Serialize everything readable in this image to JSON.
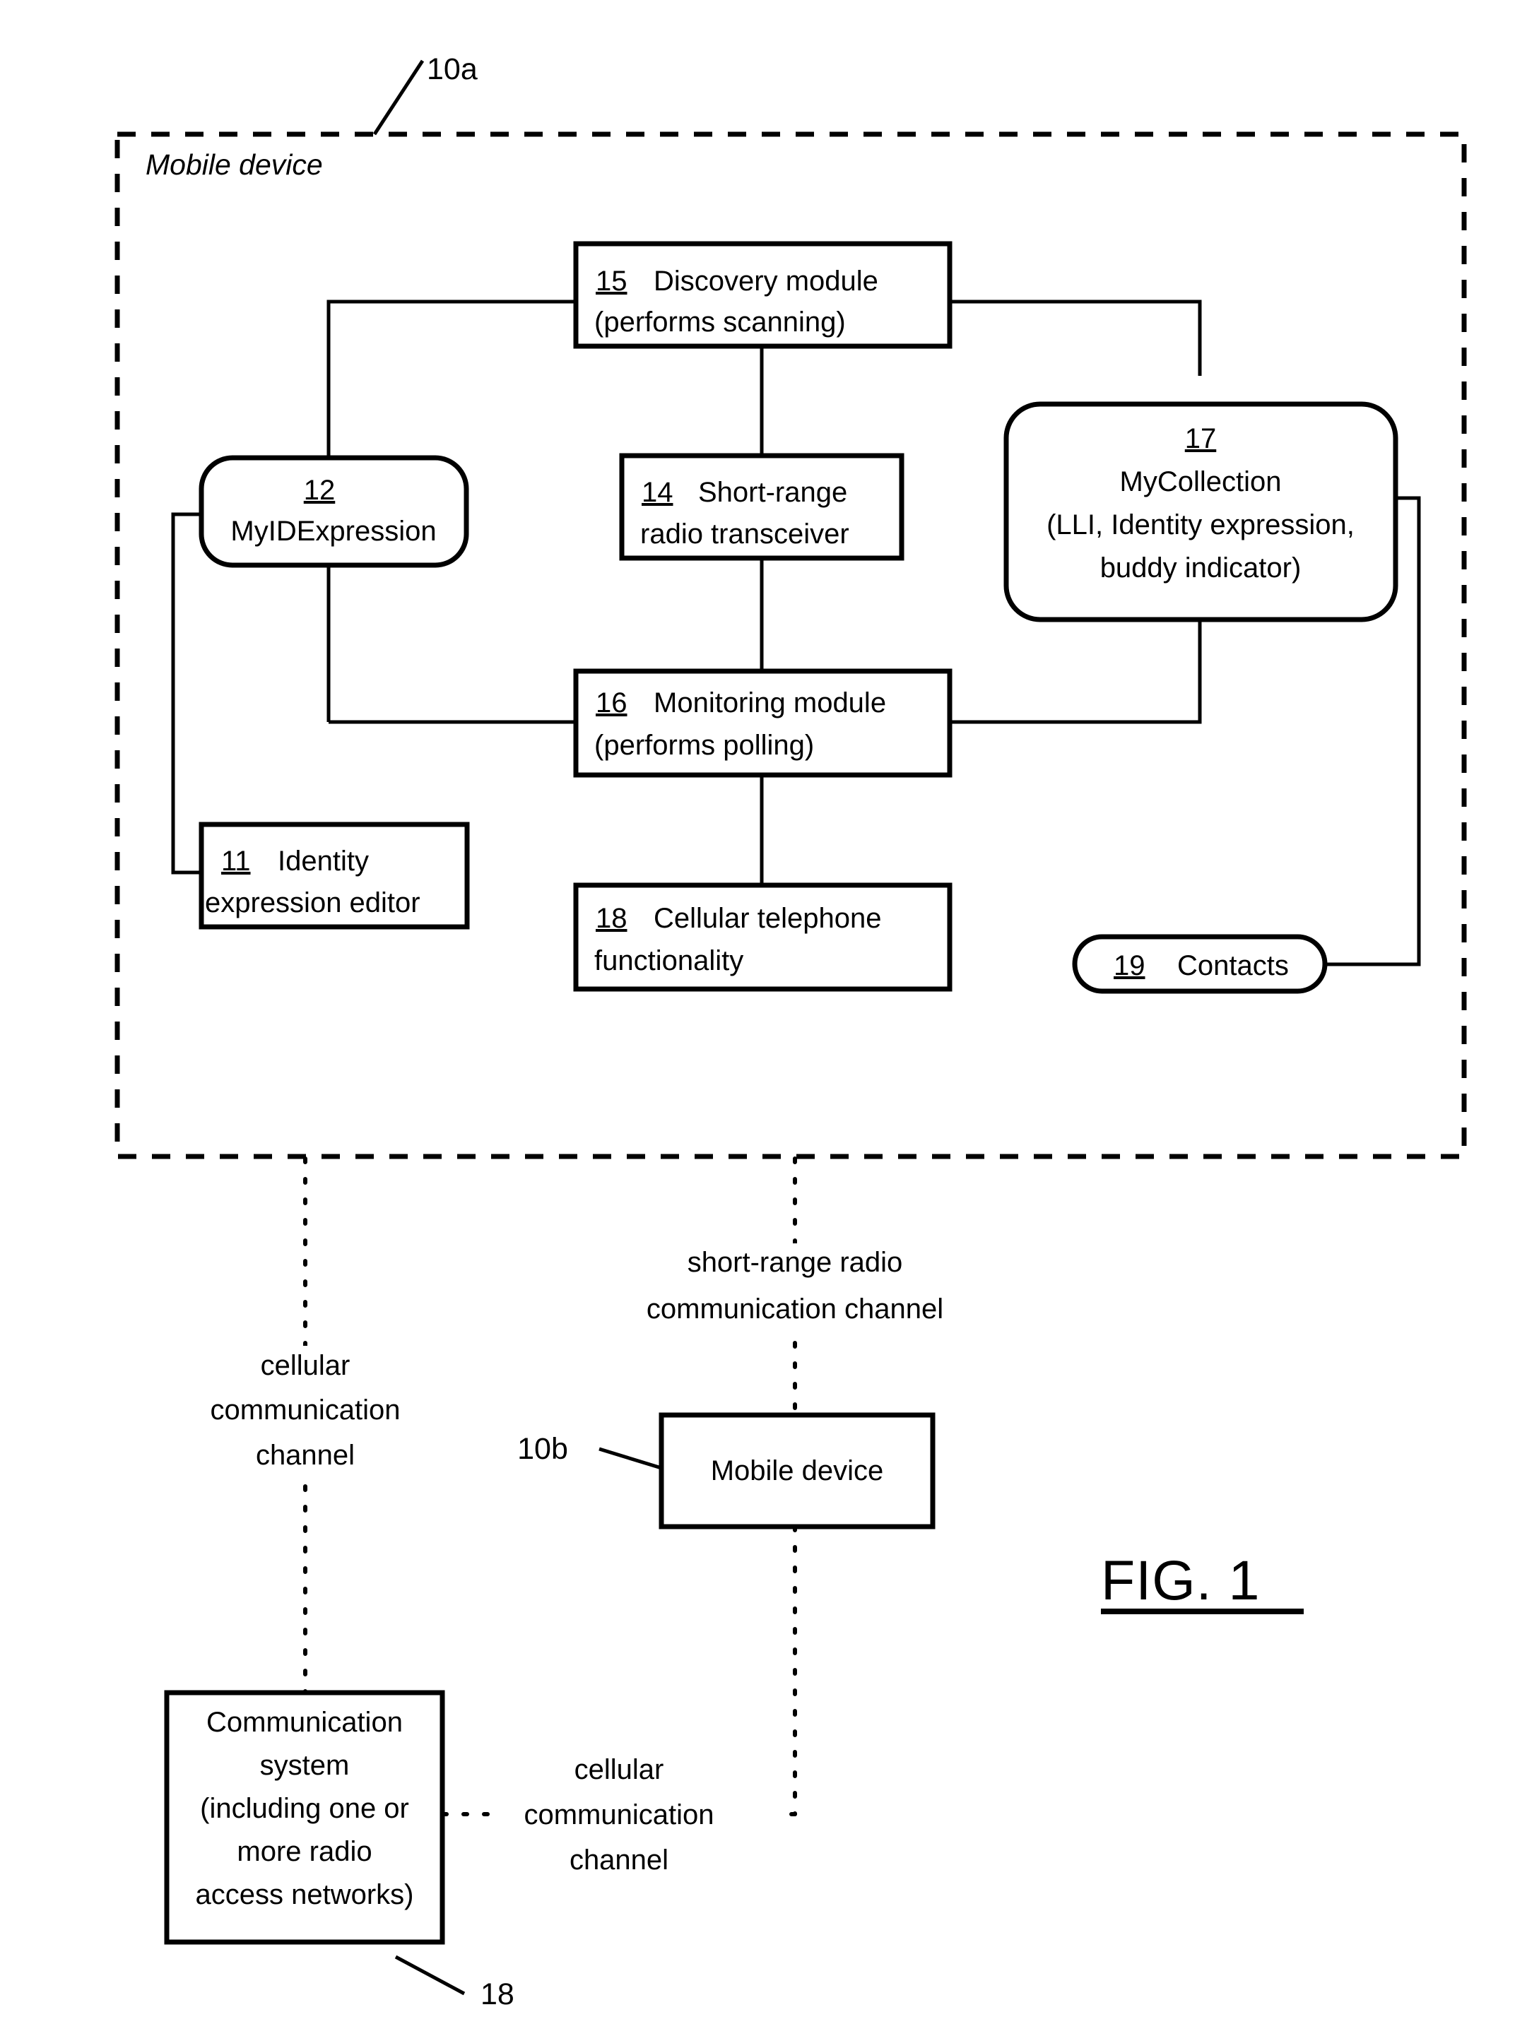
{
  "figure": {
    "label": "FIG. 1",
    "frame": {
      "callout": "10a",
      "label": "Mobile device"
    }
  },
  "blocks": {
    "discovery_module": {
      "ref": "15",
      "line1": "Discovery module",
      "line2": "(performs scanning)"
    },
    "myidexpression": {
      "ref": "12",
      "line1": "MyIDExpression"
    },
    "short_range_radio": {
      "ref": "14",
      "line1": "Short-range",
      "line2": "radio transceiver"
    },
    "mycollection": {
      "ref": "17",
      "line1": "MyCollection",
      "line2": "(LLI, Identity expression,",
      "line3": "buddy indicator)"
    },
    "monitoring_module": {
      "ref": "16",
      "line1": "Monitoring  module",
      "line2": "(performs polling)"
    },
    "identity_expression_editor": {
      "ref": "11",
      "line1": "Identity",
      "line2": "expression editor"
    },
    "cellular_telephone_functionality": {
      "ref": "18",
      "line1": "Cellular telephone",
      "line2": "functionality"
    },
    "contacts": {
      "ref": "19",
      "line1": "Contacts"
    },
    "mobile_device_b": {
      "callout": "10b",
      "line1": "Mobile device"
    },
    "communication_system": {
      "callout": "18",
      "line1": "Communication",
      "line2": "system",
      "line3": "(including one or",
      "line4": "more radio",
      "line5": "access networks)"
    }
  },
  "channels": {
    "short_range": {
      "line1": "short-range radio",
      "line2": "communication channel"
    },
    "cellular_left": {
      "line1": "cellular",
      "line2": "communication",
      "line3": "channel"
    },
    "cellular_bottom": {
      "line1": "cellular",
      "line2": "communication",
      "line3": "channel"
    }
  }
}
